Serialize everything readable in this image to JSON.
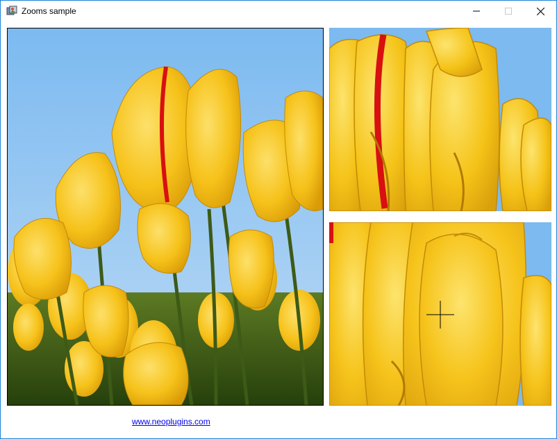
{
  "window": {
    "title": "Zooms sample",
    "icons": {
      "app": "app-icon",
      "minimize": "minimize-icon",
      "maximize": "maximize-icon",
      "close": "close-icon"
    }
  },
  "views": {
    "main": "tulip-photo",
    "zoom_top": "zoomed-tulip-photo",
    "zoom_bottom": "zoomed-tulip-photo",
    "cursor": "crosshair-icon"
  },
  "footer": {
    "link_text": "www.neoplugins.com"
  },
  "colors": {
    "sky": "#6fb3ec",
    "petal": "#f5c318",
    "petal_shadow": "#d9a00c",
    "red_streak": "#d81010",
    "stem": "#3d5a17",
    "link": "#0000ee",
    "window_border": "#1883d7"
  }
}
